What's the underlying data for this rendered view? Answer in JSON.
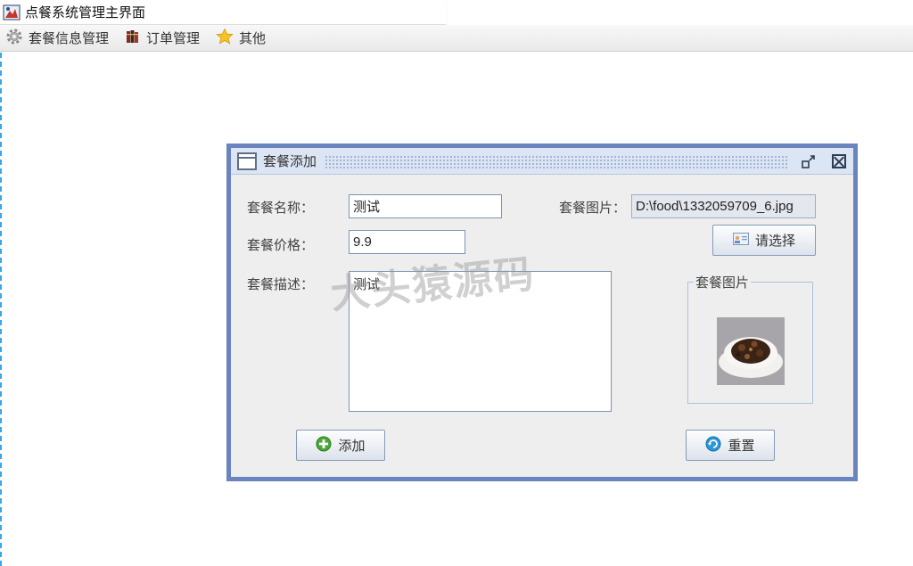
{
  "window": {
    "title": "点餐系统管理主界面"
  },
  "menubar": {
    "items": [
      {
        "label": "套餐信息管理",
        "icon": "gear-icon"
      },
      {
        "label": "订单管理",
        "icon": "books-icon"
      },
      {
        "label": "其他",
        "icon": "star-icon"
      }
    ]
  },
  "dialog": {
    "title": "套餐添加",
    "name_label": "套餐名称：",
    "name_value": "测试",
    "price_label": "套餐价格：",
    "price_value": "9.9",
    "desc_label": "套餐描述：",
    "desc_value": "测试",
    "image_label": "套餐图片：",
    "image_path": "D:\\food\\1332059709_6.jpg",
    "choose_button": "请选择",
    "image_group_title": "套餐图片",
    "add_button": "添加",
    "reset_button": "重置"
  },
  "watermark": "大头猿源码",
  "colors": {
    "frame_border": "#6a84c0",
    "accent": "#38a6e8"
  }
}
